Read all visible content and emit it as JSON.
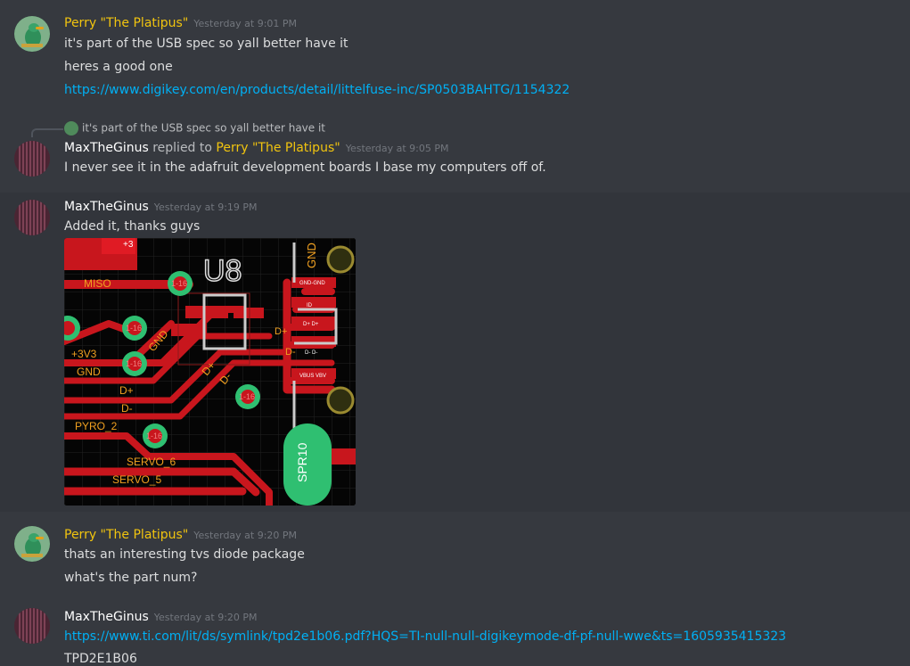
{
  "messages": [
    {
      "author": "Perry \"The Platipus\"",
      "timestamp": "Yesterday at 9:01 PM",
      "lines": [
        "it's part of the USB spec so yall better have it",
        "heres a good one"
      ],
      "link": "https://www.digikey.com/en/products/detail/littelfuse-inc/SP0503BAHTG/1154322"
    },
    {
      "reply_to_text": "it's part of the USB spec so yall better have it",
      "author": "MaxTheGinus",
      "replied_to_label": "replied to",
      "replied_to_author": "Perry \"The Platipus\"",
      "timestamp": "Yesterday at 9:05 PM",
      "text": "I never see it in the adafruit development boards I base my computers off of."
    },
    {
      "author": "MaxTheGinus",
      "timestamp": "Yesterday at 9:19 PM",
      "text": "Added it, thanks guys",
      "pcb_labels": {
        "u8": "U8",
        "miso": "MISO",
        "v33": "+3V3",
        "gnd": "GND",
        "dplus": "D+",
        "dminus": "D-",
        "pyro2": "PYRO_2",
        "servo6": "SERVO_6",
        "servo5": "SERVO_5",
        "via": "1-16",
        "gnd_rot": "GND",
        "dplus_rot": "D+",
        "dminus_rot": "D-",
        "gnd_vert": "GND",
        "spr": "SPR10",
        "plus3": "+3",
        "dplus_pad": "D+",
        "dminus_pad": "D-",
        "gnd_gnd": "GND-GND",
        "id": "ID",
        "dd_plus": "D+ D+",
        "dd_minus": "D- D-",
        "vbus": "VBUS VBV"
      }
    },
    {
      "author": "Perry \"The Platipus\"",
      "timestamp": "Yesterday at 9:20 PM",
      "lines": [
        "thats an interesting tvs diode package",
        "what's the part num?"
      ]
    },
    {
      "author": "MaxTheGinus",
      "timestamp": "Yesterday at 9:20 PM",
      "link": "https://www.ti.com/lit/ds/symlink/tpd2e1b06.pdf?HQS=TI-null-null-digikeymode-df-pf-null-wwe&ts=1605935415323",
      "text": "TPD2E1B06"
    }
  ],
  "colors": {
    "background": "#36393f",
    "highlight_row": "#32353b",
    "perry_name": "#f1c40f",
    "link": "#00b0f4",
    "timestamp": "#72767d",
    "pcb_trace": "#c8161d",
    "pcb_via": "#2fbf71",
    "pcb_text": "#f0a020"
  }
}
